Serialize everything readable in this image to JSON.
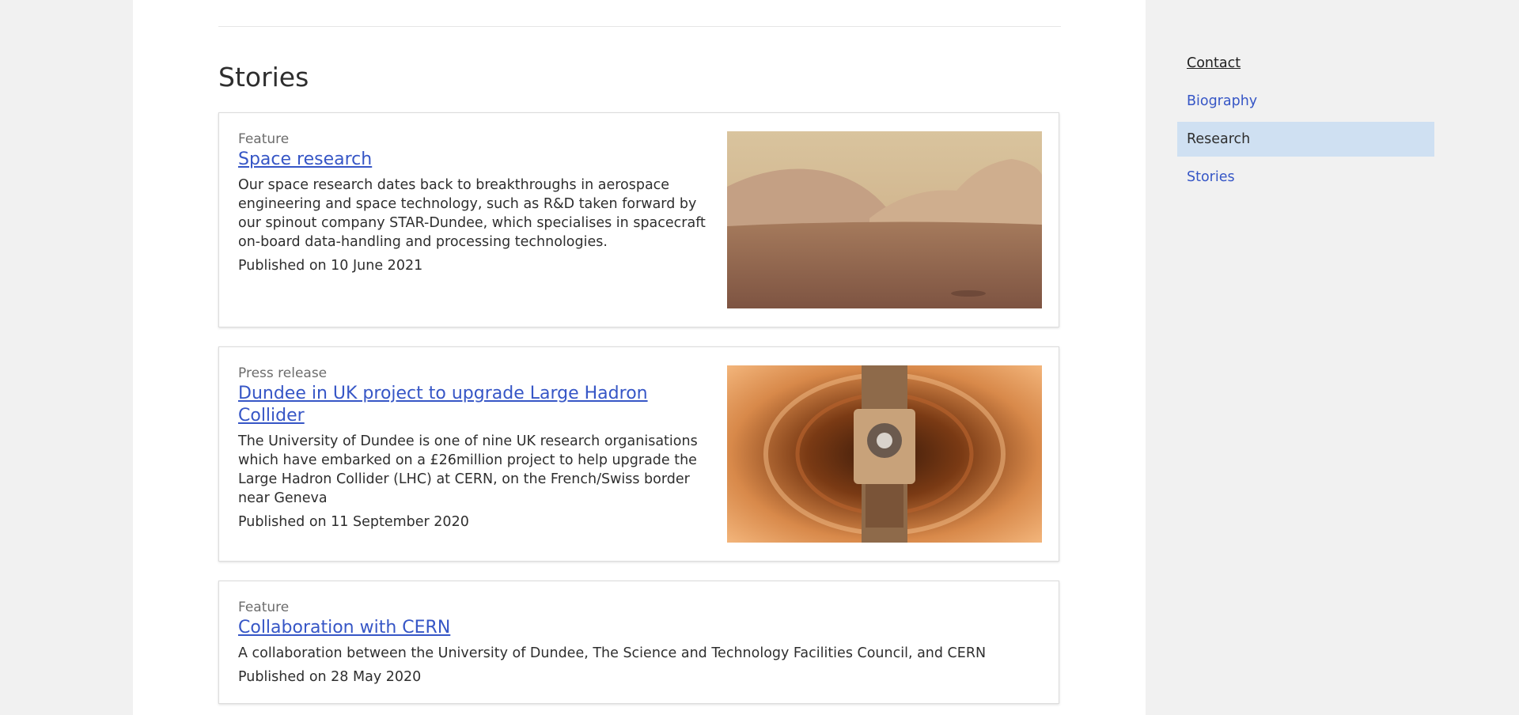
{
  "section_title": "Stories",
  "stories": [
    {
      "type": "Feature",
      "title": "Space research",
      "description": "Our space research dates back to breakthroughs in aerospace engineering and space technology, such as R&D taken forward by our spinout company STAR-Dundee, which specialises in spacecraft on-board data-handling and processing technologies.",
      "date": "Published on 10 June 2021"
    },
    {
      "type": "Press release",
      "title": "Dundee in UK project to upgrade Large Hadron Collider",
      "description": "The University of Dundee is one of nine UK research organisations which have embarked on a £26million project to help upgrade the Large Hadron Collider (LHC) at CERN, on the French/Swiss border near Geneva",
      "date": "Published on 11 September 2020"
    },
    {
      "type": "Feature",
      "title": "Collaboration with CERN",
      "description": "A collaboration between the University of Dundee, The Science and Technology Facilities Council, and CERN",
      "date": "Published on 28 May 2020"
    }
  ],
  "side_nav": {
    "items": [
      "Contact",
      "Biography",
      "Research",
      "Stories"
    ],
    "active": "Research"
  },
  "colors": {
    "link": "#3656c6",
    "active_nav_bg": "#cfe0f2",
    "page_bg": "#f1f1f1"
  }
}
